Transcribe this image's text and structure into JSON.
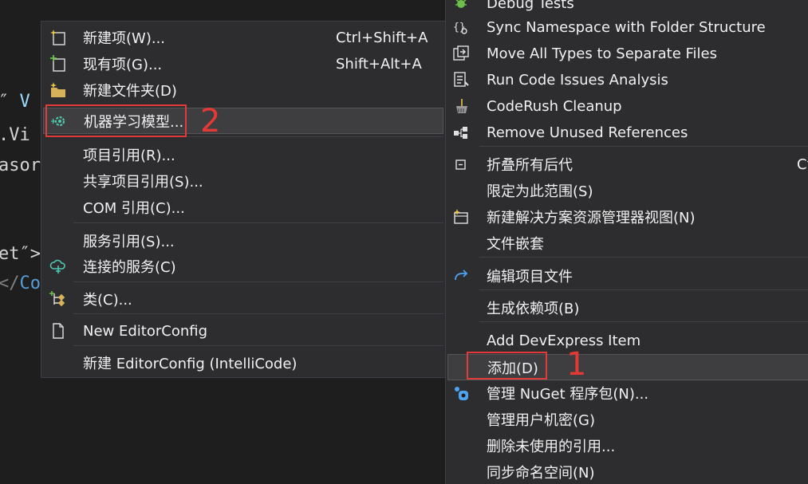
{
  "code_fragments": {
    "line1_quote": "″",
    "line1_blue": "V",
    "line2": ".Vi",
    "line3": "asorl",
    "line4": "et″>",
    "line5_prefix": "</",
    "line5_blue": "Co"
  },
  "submenu": {
    "items": [
      {
        "label": "新建项(W)...",
        "shortcut": "Ctrl+Shift+A",
        "icon": "new-item-icon"
      },
      {
        "label": "现有项(G)...",
        "shortcut": "Shift+Alt+A",
        "icon": "existing-item-icon"
      },
      {
        "label": "新建文件夹(D)",
        "shortcut": "",
        "icon": "new-folder-icon"
      },
      {
        "label": "机器学习模型...",
        "shortcut": "",
        "icon": "ml-model-gear-icon"
      },
      {
        "label": "项目引用(R)...",
        "shortcut": "",
        "icon": ""
      },
      {
        "label": "共享项目引用(S)...",
        "shortcut": "",
        "icon": ""
      },
      {
        "label": "COM 引用(C)...",
        "shortcut": "",
        "icon": ""
      },
      {
        "label": "服务引用(S)...",
        "shortcut": "",
        "icon": ""
      },
      {
        "label": "连接的服务(C)",
        "shortcut": "",
        "icon": "connected-service-icon"
      },
      {
        "label": "类(C)...",
        "shortcut": "",
        "icon": "class-icon"
      },
      {
        "label": "New EditorConfig",
        "shortcut": "",
        "icon": "document-icon"
      },
      {
        "label": "新建 EditorConfig (IntelliCode)",
        "shortcut": "",
        "icon": ""
      }
    ]
  },
  "mainmenu": {
    "items": [
      {
        "label": "Debug Tests",
        "shortcut": "",
        "icon": "bug-icon"
      },
      {
        "label": "Sync Namespace with Folder Structure",
        "shortcut": "",
        "icon": "namespace-icon"
      },
      {
        "label": "Move All Types to Separate Files",
        "shortcut": "",
        "icon": "move-types-icon"
      },
      {
        "label": "Run Code Issues Analysis",
        "shortcut": "",
        "icon": "code-analysis-icon"
      },
      {
        "label": "CodeRush Cleanup",
        "shortcut": "",
        "icon": "broom-icon"
      },
      {
        "label": "Remove Unused References",
        "shortcut": "",
        "icon": "remove-references-icon"
      },
      {
        "label": "折叠所有后代",
        "shortcut": "Ct",
        "icon": "collapse-icon"
      },
      {
        "label": "限定为此范围(S)",
        "shortcut": "",
        "icon": ""
      },
      {
        "label": "新建解决方案资源管理器视图(N)",
        "shortcut": "",
        "icon": "new-view-icon"
      },
      {
        "label": "文件嵌套",
        "shortcut": "",
        "icon": ""
      },
      {
        "label": "编辑项目文件",
        "shortcut": "",
        "icon": "redo-arrow-icon"
      },
      {
        "label": "生成依赖项(B)",
        "shortcut": "",
        "icon": ""
      },
      {
        "label": "Add DevExpress Item",
        "shortcut": "",
        "icon": ""
      },
      {
        "label": "添加(D)",
        "shortcut": "",
        "icon": ""
      },
      {
        "label": "管理 NuGet 程序包(N)...",
        "shortcut": "",
        "icon": "nuget-icon"
      },
      {
        "label": "管理用户机密(G)",
        "shortcut": "",
        "icon": ""
      },
      {
        "label": "删除未使用的引用...",
        "shortcut": "",
        "icon": ""
      },
      {
        "label": "同步命名空间(N)",
        "shortcut": "",
        "icon": ""
      }
    ]
  },
  "annotations": {
    "step1": "1",
    "step2": "2"
  },
  "colors": {
    "menu_bg": "#2d2d30",
    "menu_border": "#3f3f46",
    "text": "#f1f1f1",
    "highlight_bg": "#3e3e40",
    "annotation_red": "#e03a3a"
  }
}
